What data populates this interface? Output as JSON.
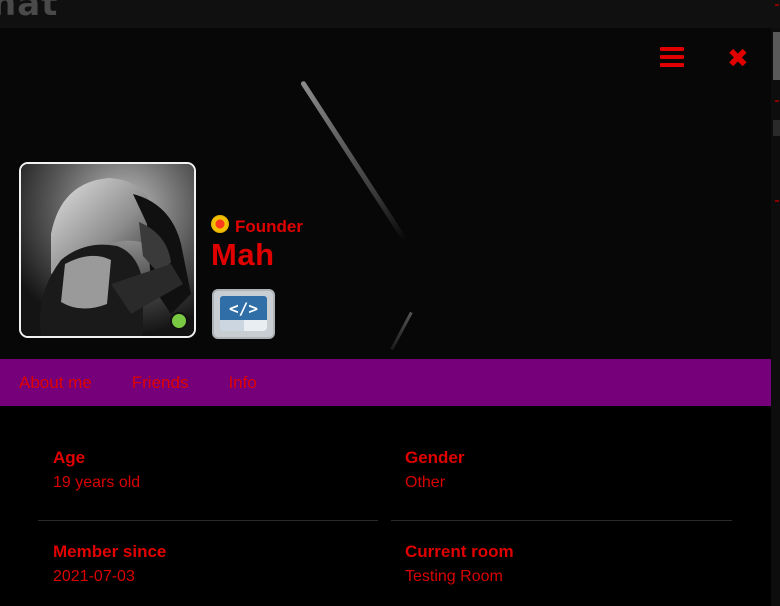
{
  "app": {
    "title": "hat"
  },
  "header": {
    "menu_icon": "hamburger-menu-icon",
    "close_icon": "close-x-icon",
    "accent_color": "#e00000"
  },
  "profile": {
    "rank": "Founder",
    "rank_icon": "founder-badge-icon",
    "username": "Mah",
    "status": "online",
    "status_color": "#7ac943",
    "badge_icon": "developer-code-badge-icon",
    "badge_glyph": "</>"
  },
  "tabs": [
    {
      "label": "About me"
    },
    {
      "label": "Friends"
    },
    {
      "label": "Info"
    }
  ],
  "tab_bar_color": "#760079",
  "info": [
    {
      "label": "Age",
      "value": "19 years old"
    },
    {
      "label": "Gender",
      "value": "Other"
    },
    {
      "label": "Member since",
      "value": "2021-07-03"
    },
    {
      "label": "Current room",
      "value": "Testing Room"
    }
  ]
}
